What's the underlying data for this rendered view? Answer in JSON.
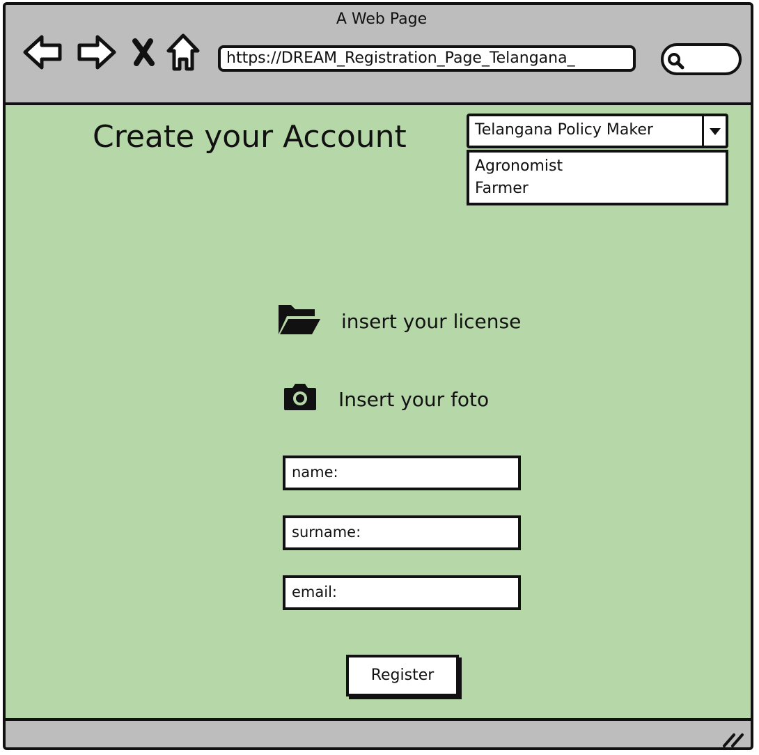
{
  "window": {
    "title": "A Web Page"
  },
  "browser": {
    "url": "https://DREAM_Registration_Page_Telangana_"
  },
  "page": {
    "heading": "Create your Account",
    "role_select": {
      "selected": "Telangana Policy Maker",
      "options": [
        "Agronomist",
        "Farmer"
      ]
    },
    "license_label": "insert your license",
    "photo_label": "Insert your foto",
    "fields": {
      "name": "name:",
      "surname": "surname:",
      "email": "email:"
    },
    "register_label": "Register"
  },
  "icons": [
    "back-arrow-icon",
    "forward-arrow-icon",
    "close-icon",
    "home-icon",
    "search-icon",
    "folder-open-icon",
    "camera-icon",
    "resize-grip-icon",
    "chevron-down-icon"
  ]
}
